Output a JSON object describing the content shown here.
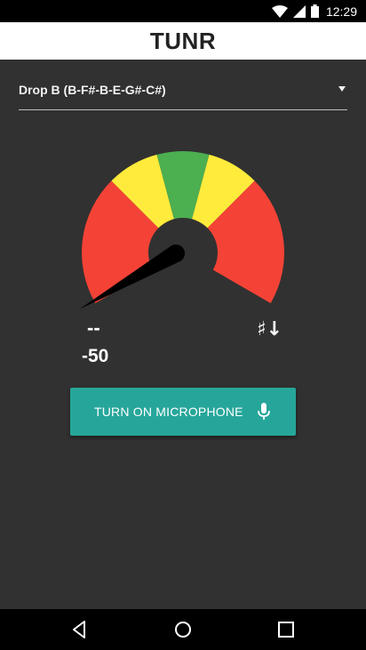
{
  "status_bar": {
    "time": "12:29",
    "icons": [
      "wifi-icon",
      "signal-icon",
      "battery-icon"
    ]
  },
  "app_bar": {
    "title": "TUNR"
  },
  "tuning": {
    "selected": "Drop B (B-F#-B-E-G#-C#)"
  },
  "meter": {
    "cents": -50,
    "needle_value_cents": -50,
    "range_cents": [
      -50,
      50
    ],
    "zone_colors": {
      "red": "#f44336",
      "yellow": "#ffeb3b",
      "green": "#4caf50",
      "hub": "#313131",
      "needle": "#000000"
    }
  },
  "readout": {
    "note": "--",
    "cents_text": "-50",
    "pitch_indicator": "♯↓"
  },
  "microphone_button": {
    "label": "TURN ON MICROPHONE",
    "icon": "microphone-icon",
    "color": "#26a69a"
  },
  "nav_bar": {
    "buttons": [
      "back-icon",
      "home-icon",
      "recents-icon"
    ]
  }
}
